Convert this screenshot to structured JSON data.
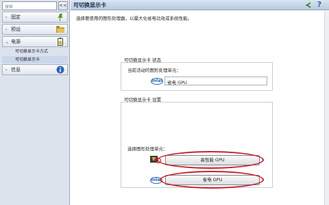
{
  "sidebar": {
    "search_placeholder": "搜索",
    "collapse_label": "<<",
    "items": [
      {
        "label": "固定",
        "arrow": "›",
        "icon": "pin-icon"
      },
      {
        "label": "预设",
        "arrow": "›",
        "icon": "folder-icon"
      },
      {
        "label": "电源",
        "arrow": "⌄",
        "icon": "battery-icon"
      },
      {
        "label": "信息",
        "arrow": "›",
        "icon": "info-icon"
      }
    ],
    "sub_items": [
      {
        "label": "可切换显示卡方式"
      },
      {
        "label": "可切换显示卡"
      }
    ]
  },
  "header": {
    "title": "可切换显示卡",
    "help_label": "?"
  },
  "main": {
    "subtitle": "选择要使用的图形处理器，以最大化省电功效或系统性能。",
    "status_group": {
      "title": "可切换显示卡 状态",
      "current_label": "当前活动的图形处理单元：",
      "current_value": "省电 GPU",
      "logo_text": "intel"
    },
    "settings_group": {
      "title": "可切换显示卡 设置",
      "select_label": "选择图形处理单元：",
      "high_perf_button": "高性能 GPU",
      "power_saving_button": "省电 GPU",
      "logo_text": "intel"
    }
  }
}
